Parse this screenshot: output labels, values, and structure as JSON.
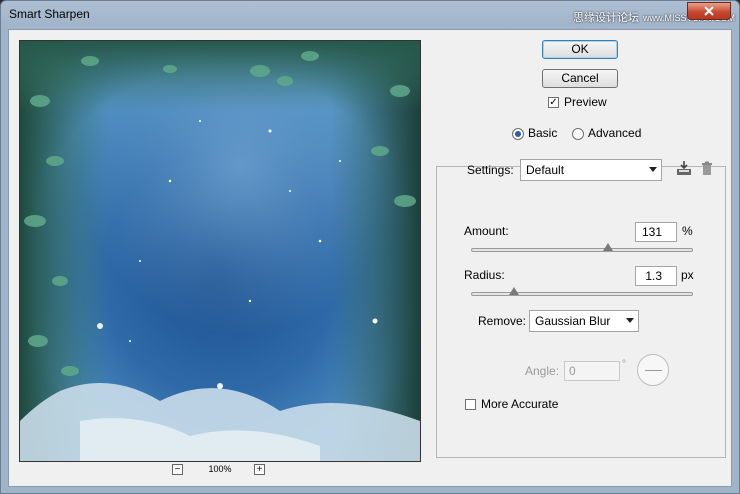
{
  "window": {
    "title": "Smart Sharpen"
  },
  "watermark": {
    "text": "思缘设计论坛",
    "site": "www.MISSVUAN.COM"
  },
  "preview": {
    "zoom_level": "100%",
    "zoom_out_glyph": "−",
    "zoom_in_glyph": "+"
  },
  "buttons": {
    "ok": "OK",
    "cancel": "Cancel"
  },
  "preview_toggle": {
    "label": "Preview",
    "checked": true,
    "check_glyph": "✓"
  },
  "mode": {
    "basic": "Basic",
    "advanced": "Advanced",
    "selected": "Basic"
  },
  "settings": {
    "label": "Settings:",
    "value": "Default",
    "save_icon": "save-settings-icon",
    "delete_icon": "trash-icon"
  },
  "amount": {
    "label": "Amount:",
    "value": "131",
    "unit": "%",
    "slider_fraction": 0.62
  },
  "radius": {
    "label": "Radius:",
    "value": "1.3",
    "unit": "px",
    "slider_fraction": 0.19
  },
  "remove": {
    "label": "Remove:",
    "value": "Gaussian Blur"
  },
  "angle": {
    "label": "Angle:",
    "value": "0",
    "unit": "°"
  },
  "more_accurate": {
    "label": "More Accurate",
    "checked": false
  }
}
